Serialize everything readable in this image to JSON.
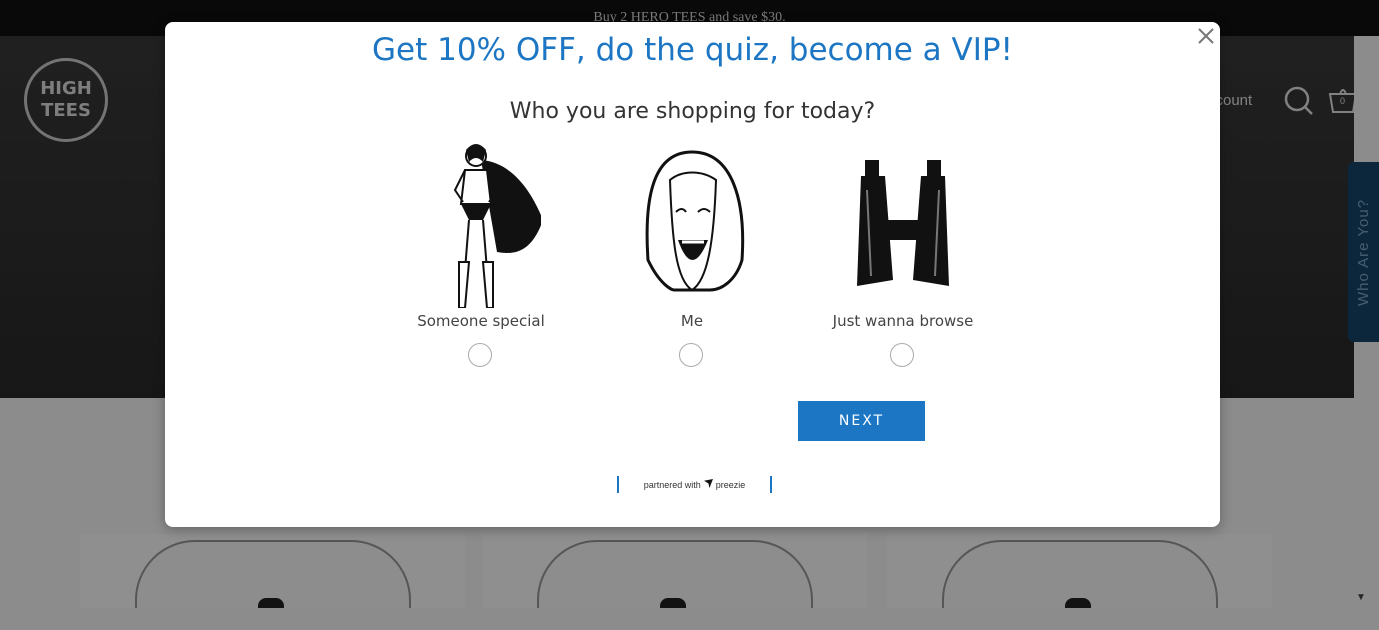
{
  "announcement": {
    "text": "Buy 2 HERO TEES and save $30."
  },
  "header": {
    "logo_line1": "HIGH",
    "logo_line2": "TEES",
    "account_label": "ccount",
    "cart_count": "0"
  },
  "side_tab": {
    "label": "Who Are You?"
  },
  "modal": {
    "title": "Get 10% OFF, do the quiz, become a VIP!",
    "question": "Who you are shopping for today?",
    "options": [
      {
        "label": "Someone special",
        "image": "superhero-woman-illustration"
      },
      {
        "label": "Me",
        "image": "laughing-woman-illustration"
      },
      {
        "label": "Just wanna browse",
        "image": "binoculars-illustration"
      }
    ],
    "next_label": "NEXT",
    "partner_prefix": "partnered with",
    "partner_name": "preezie"
  },
  "colors": {
    "accent": "#1c76c3",
    "overlay": "rgba(0,0,0,0.44)",
    "side_tab": "#17456a"
  }
}
